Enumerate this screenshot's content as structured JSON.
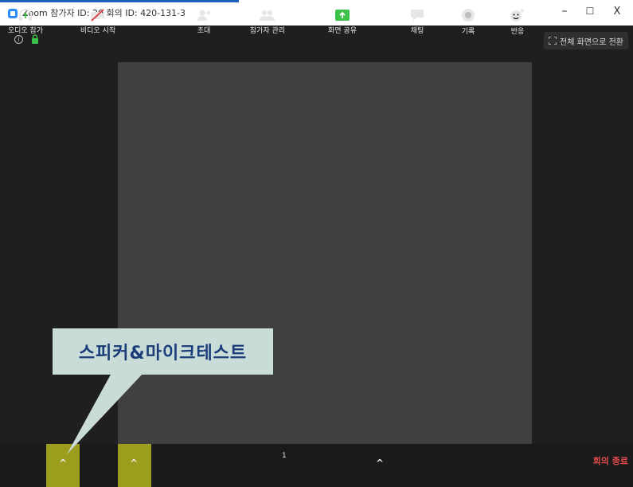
{
  "titlebar": {
    "title": "Zoom 참가자 ID: 20   회의 ID: 420-131-3",
    "minimize": "–",
    "maximize": "☐",
    "close": "X"
  },
  "stage": {
    "fullscreen_label": "전체 화면으로 전환"
  },
  "toolbar": {
    "audio_label": "오디오 참가",
    "video_label": "비디오 시작",
    "invite_label": "초대",
    "participants_label": "참가자 관리",
    "participants_count": "1",
    "share_label": "화면 공유",
    "chat_label": "채팅",
    "record_label": "기록",
    "reactions_label": "반응",
    "end_label": "회의 종료",
    "highlight_color": "#b5b51f"
  },
  "callout": {
    "text": "스피커&마이크테스트",
    "bg_color": "#c9dcd8",
    "text_color": "#1a3d7a"
  }
}
